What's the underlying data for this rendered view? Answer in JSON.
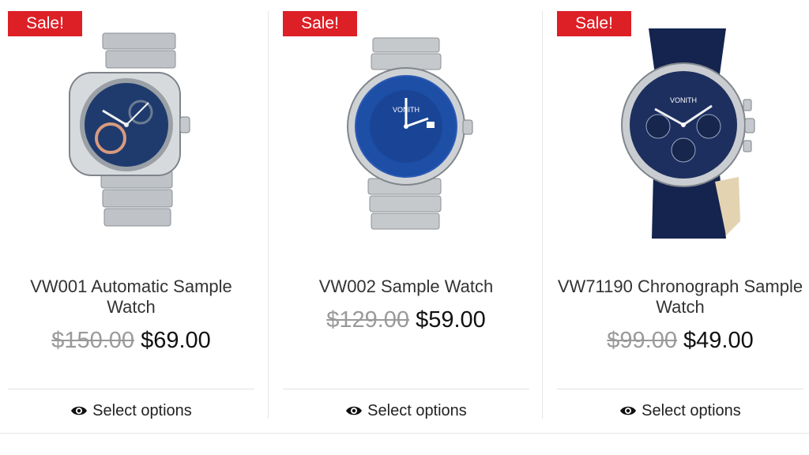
{
  "products": [
    {
      "badge": "Sale!",
      "title": "VW001 Automatic Sample Watch",
      "old_price": "$150.00",
      "new_price": "$69.00",
      "action": "Select options",
      "image_desc": "Silver steel automatic watch with skeleton dial",
      "dial_color": "#1f3b6e"
    },
    {
      "badge": "Sale!",
      "title": "VW002 Sample Watch",
      "old_price": "$129.00",
      "new_price": "$59.00",
      "action": "Select options",
      "image_desc": "Blue dive watch with steel bracelet",
      "dial_color": "#1d4fa6",
      "logo_text": "VONITH"
    },
    {
      "badge": "Sale!",
      "title": "VW71190 Chronograph Sample Watch",
      "old_price": "$99.00",
      "new_price": "$49.00",
      "action": "Select options",
      "image_desc": "Navy chronograph with leather strap",
      "dial_color": "#1d2f5e",
      "logo_text": "VONITH"
    }
  ],
  "colors": {
    "badge": "#dd1f26",
    "old_price": "#9a9a9a",
    "new_price": "#111111"
  },
  "icons": {
    "action": "eye-icon"
  }
}
